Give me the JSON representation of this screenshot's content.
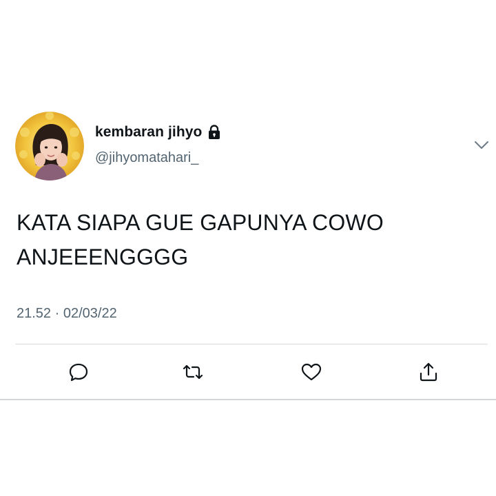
{
  "tweet": {
    "display_name": "kembaran jihyo",
    "handle": "@jihyomatahari_",
    "protected_icon": "lock-icon",
    "text_line1": "KATA SIAPA GUE GAPUNYA COWO",
    "text_line2": "ANJEEENGGGG",
    "time": "21.52",
    "separator": "·",
    "date": "02/03/22"
  },
  "actions": [
    "reply-icon",
    "retweet-icon",
    "like-icon",
    "share-icon"
  ],
  "colors": {
    "text": "#0f1419",
    "secondary": "#536471",
    "divider": "#d9dde1",
    "avatar_ring": "#f2c53d"
  }
}
